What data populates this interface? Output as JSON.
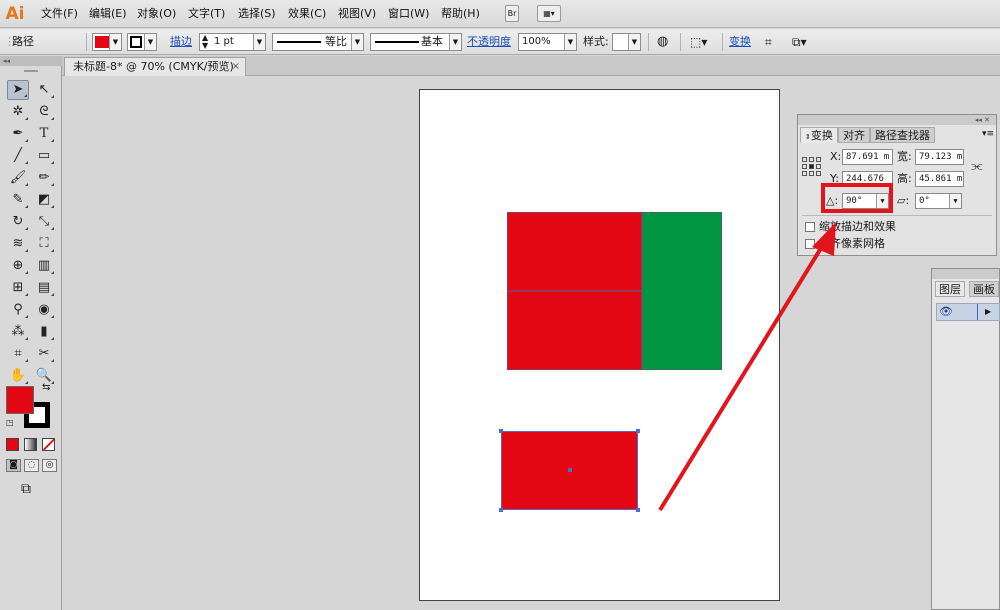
{
  "app": {
    "logo": "Ai"
  },
  "menu": {
    "items": [
      "文件(F)",
      "编辑(E)",
      "对象(O)",
      "文字(T)",
      "选择(S)",
      "效果(C)",
      "视图(V)",
      "窗口(W)",
      "帮助(H)"
    ],
    "bridge_label": "Br"
  },
  "control_bar": {
    "selection_type": "路径",
    "fill_color": "#e30613",
    "stroke_label": "描边",
    "stroke_weight": "1 pt",
    "stroke_profile": "等比",
    "brush": "基本",
    "opacity_label": "不透明度",
    "opacity_value": "100%",
    "style_label": "样式:",
    "transform_label": "变换"
  },
  "document": {
    "tab_title": "未标题-8* @ 70% (CMYK/预览)",
    "close_glyph": "×"
  },
  "toolbox": {
    "grip_glyph": "◂◂",
    "fill_color": "#e30613",
    "stroke_color": "#000000",
    "tools": [
      "selection-tool",
      "direct-selection-tool",
      "magic-wand-tool",
      "lasso-tool",
      "pen-tool",
      "type-tool",
      "line-tool",
      "rectangle-tool",
      "paintbrush-tool",
      "pencil-tool",
      "blob-brush-tool",
      "eraser-tool",
      "rotate-tool",
      "scale-tool",
      "width-tool",
      "free-transform-tool",
      "shape-builder-tool",
      "perspective-grid-tool",
      "mesh-tool",
      "gradient-tool",
      "eyedropper-tool",
      "blend-tool",
      "symbol-sprayer-tool",
      "column-graph-tool",
      "artboard-tool",
      "slice-tool",
      "hand-tool",
      "zoom-tool"
    ]
  },
  "artwork": {
    "red": "#e30613",
    "green": "#009540",
    "selection_color": "#4f6bd0"
  },
  "transform_panel": {
    "tabs": [
      "变换",
      "对齐",
      "路径查找器"
    ],
    "x_label": "X:",
    "x_value": "87.691 m",
    "y_label": "Y:",
    "y_value": "244.676",
    "w_label": "宽:",
    "w_value": "79.123 m",
    "h_label": "高:",
    "h_value": "45.861 m",
    "rotate_label": "△:",
    "rotate_value": "90°",
    "shear_label": "▱:",
    "shear_value": "0°",
    "scale_strokes_label": "缩放描边和效果",
    "align_pixel_label": "对齐像素网格",
    "menu_glyph": "▾≡"
  },
  "layers_panel": {
    "tabs": [
      "图层",
      "画板"
    ],
    "eye_glyph": "👁"
  },
  "annotation": {
    "color": "#e2141c"
  }
}
